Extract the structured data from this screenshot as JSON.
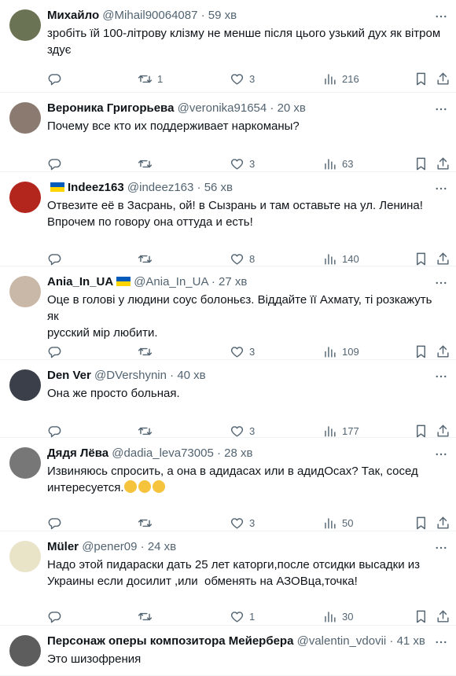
{
  "tweets": [
    {
      "name": "Михайло",
      "handle": "@Mihail90064087",
      "sep": "·",
      "time": "59 хв",
      "flag_before": false,
      "flag_after": false,
      "text": "зробіть їй 100-літрову клізму не менше після цього узький дух як вітром здує",
      "replies": "",
      "retweets": "1",
      "likes": "3",
      "views": "216",
      "avatar_color": "#6b7355"
    },
    {
      "name": "Вероника Григорьева",
      "handle": "@veronika91654",
      "sep": "·",
      "time": "20 хв",
      "flag_before": false,
      "flag_after": false,
      "text": "Почему все кто их поддерживает наркоманы?",
      "replies": "",
      "retweets": "",
      "likes": "3",
      "views": "63",
      "avatar_color": "#8a7a70"
    },
    {
      "name": "Indeez163",
      "handle": "@indeez163",
      "sep": "·",
      "time": "56 хв",
      "flag_before": true,
      "flag_after": false,
      "text": "Отвезите её в Засрань, ой! в Сызрань и там оставьте на ул. Ленина!\nВпрочем по говору она оттуда и есть!",
      "replies": "",
      "retweets": "",
      "likes": "8",
      "views": "140",
      "avatar_color": "#b3261e"
    },
    {
      "name": "Ania_In_UA",
      "handle": "@Ania_In_UA",
      "sep": "·",
      "time": "27 хв",
      "flag_before": false,
      "flag_after": true,
      "text": "Оце в голові у людини соус болоньєз. Віддайте її Ахмату, ті розкажуть як\nрусский мір любити.",
      "replies": "",
      "retweets": "",
      "likes": "3",
      "views": "109",
      "avatar_color": "#c9b8a8"
    },
    {
      "name": "Den Ver",
      "handle": "@DVershynin",
      "sep": "·",
      "time": "40 хв",
      "flag_before": false,
      "flag_after": false,
      "text": "Она же просто больная.",
      "replies": "",
      "retweets": "",
      "likes": "3",
      "views": "177",
      "avatar_color": "#3a3f4a"
    },
    {
      "name": "Дядя Лёва",
      "handle": "@dadia_leva73005",
      "sep": "·",
      "time": "28 хв",
      "flag_before": false,
      "flag_after": false,
      "text": "Извиняюсь спросить, а она в адидасах или в адидОсах? Так, сосед\nинтересуется.",
      "emoji_count": 3,
      "replies": "",
      "retweets": "",
      "likes": "3",
      "views": "50",
      "avatar_color": "#777777"
    },
    {
      "name": "Müler",
      "handle": "@pener09",
      "sep": "·",
      "time": "24 хв",
      "flag_before": false,
      "flag_after": false,
      "text": "Надо этой пидараски дать 25 лет каторги,после отсидки высадки из\nУкраины если досилит ,или  обменять на АЗОВца,точка!",
      "replies": "",
      "retweets": "",
      "likes": "1",
      "views": "30",
      "avatar_color": "#e9e3c8"
    },
    {
      "name": "Персонаж оперы композитора Мейербера",
      "handle": "@valentin_vdovii",
      "sep": "·",
      "time": "41 хв",
      "flag_before": false,
      "flag_after": false,
      "text": "Это шизофрения",
      "replies": "",
      "retweets": "",
      "likes": "",
      "views": "",
      "avatar_color": "#5d5d5d"
    }
  ],
  "colors": {
    "text": "#0f1419",
    "muted": "#536471",
    "divider": "#eff3f4",
    "flag_blue": "#005bbb",
    "flag_yellow": "#ffd500"
  },
  "icons": {
    "reply": "reply-icon",
    "retweet": "retweet-icon",
    "like": "heart-icon",
    "views": "views-chart-icon",
    "bookmark": "bookmark-icon",
    "share": "share-icon",
    "more": "more-dots-icon"
  }
}
